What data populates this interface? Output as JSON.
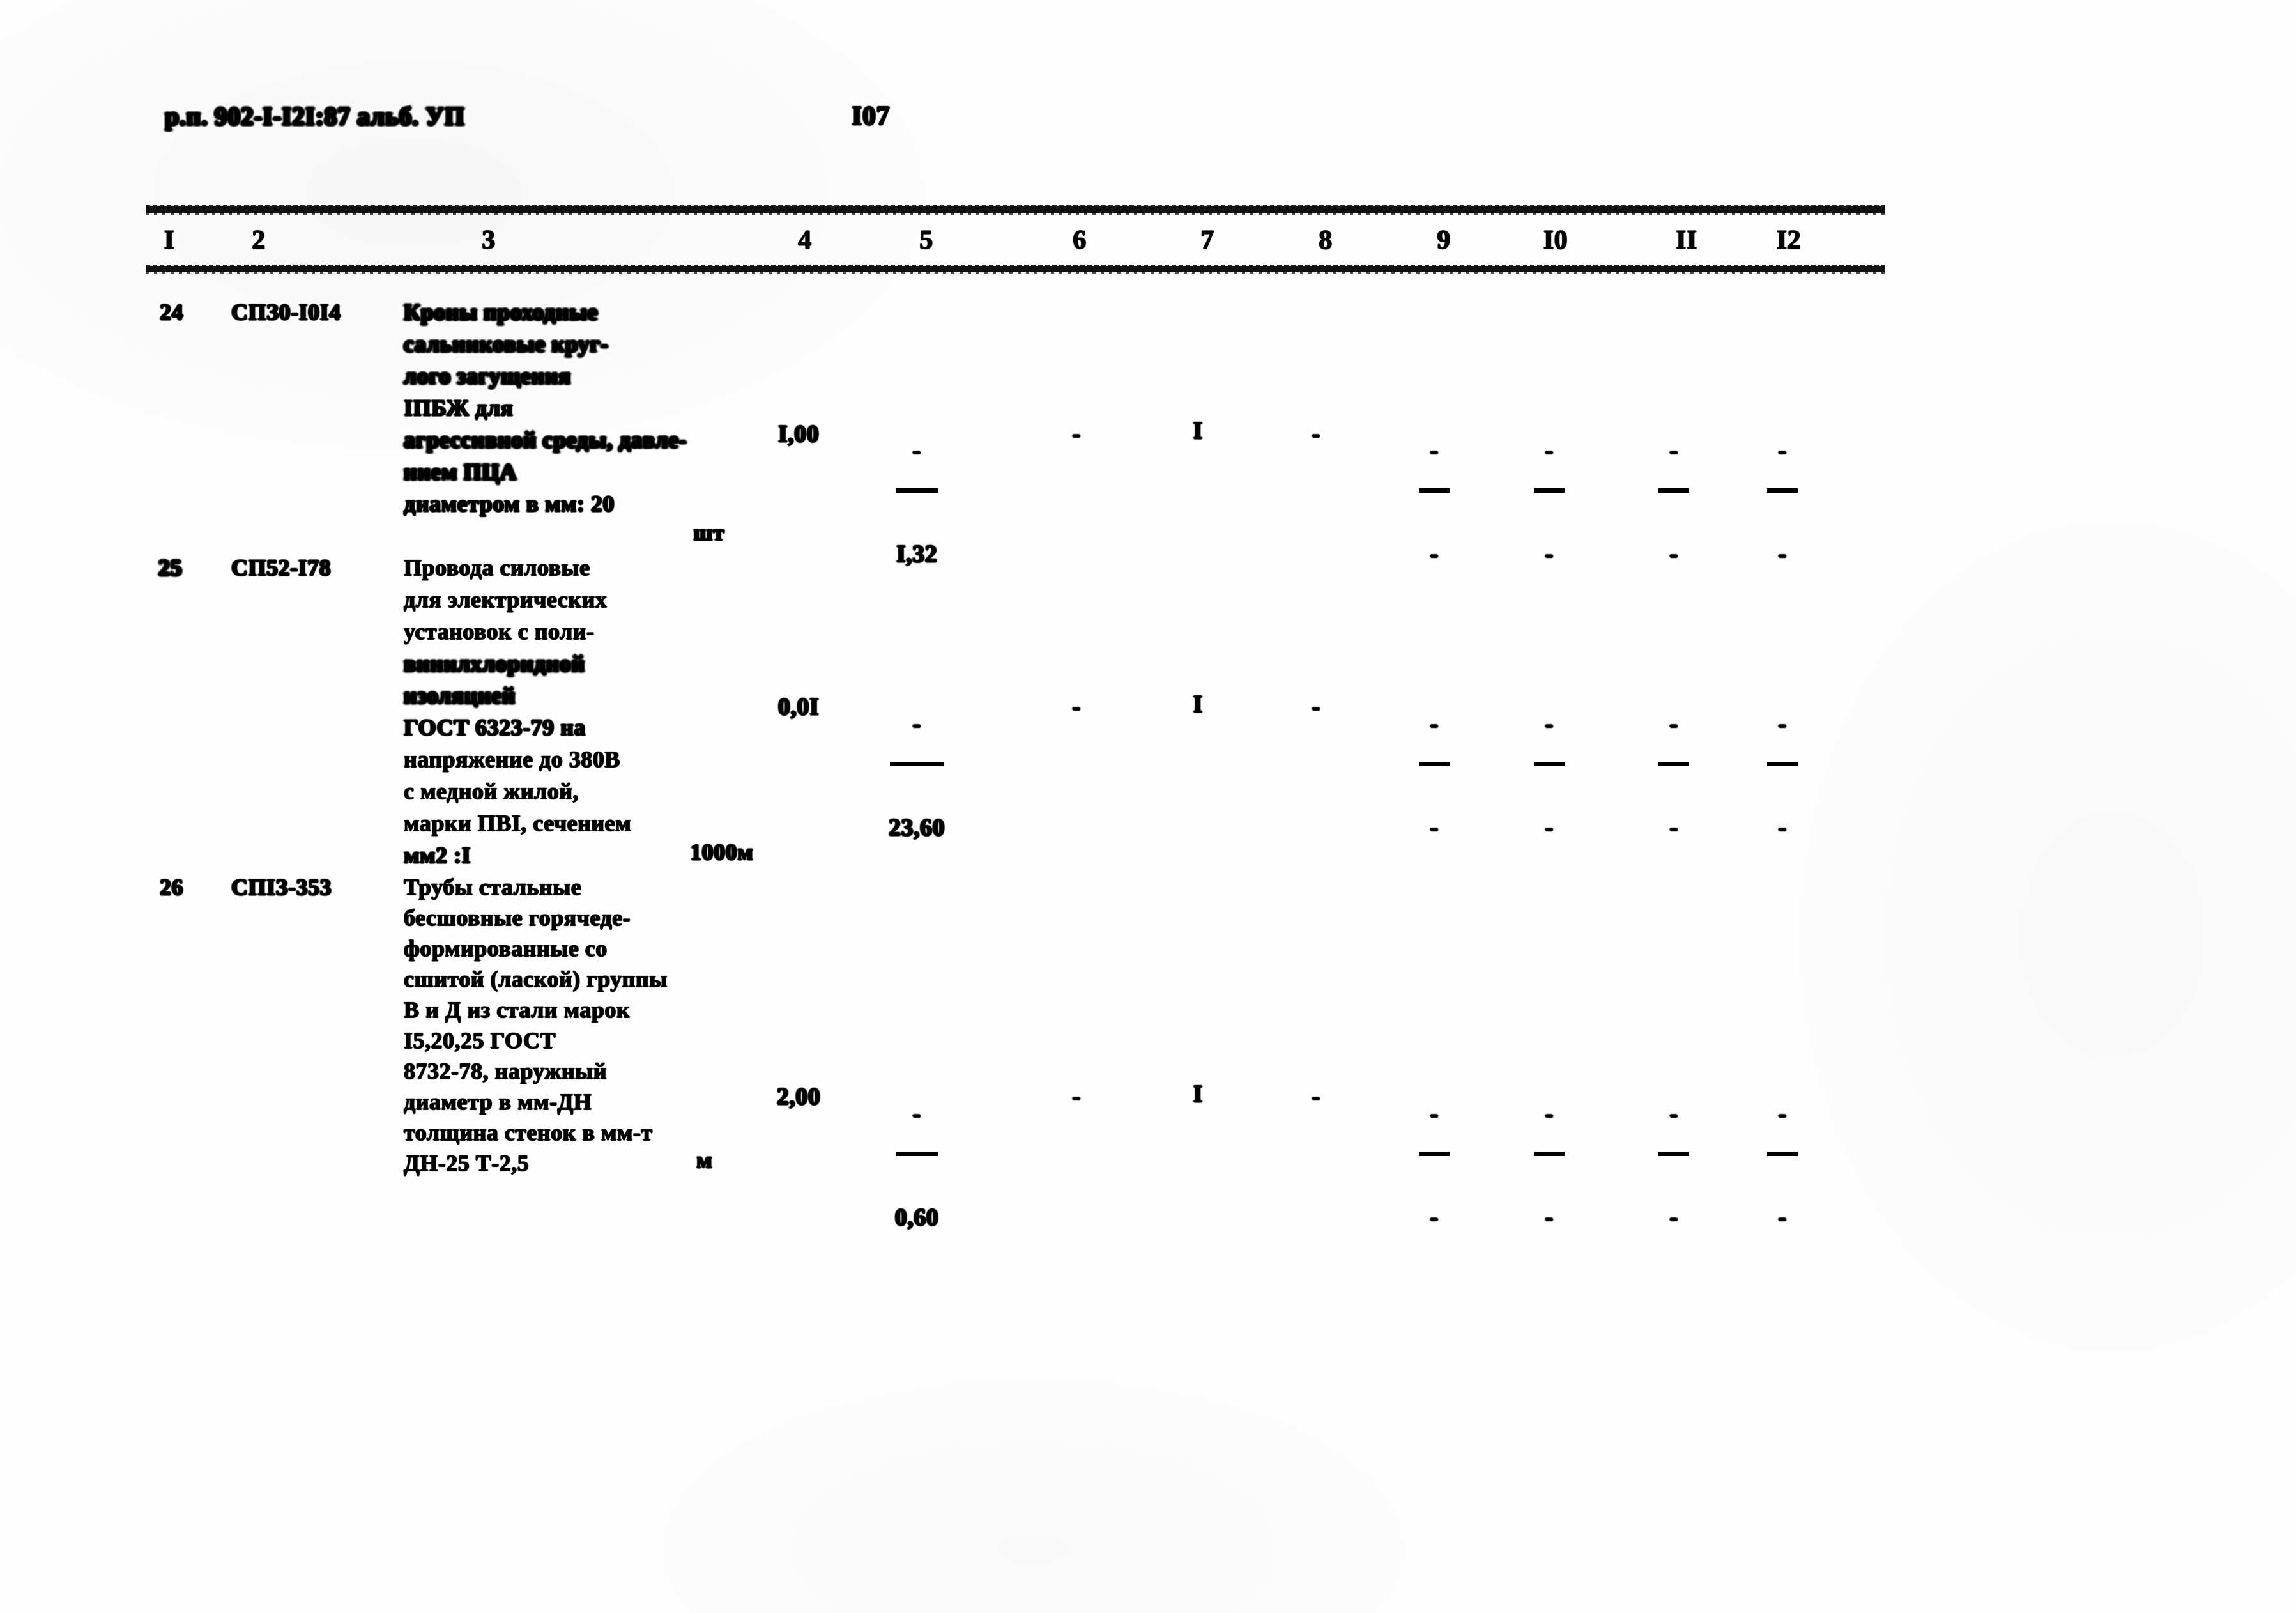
{
  "document": {
    "header_code": "р.п. 902-I-I2I:87 альб. УП",
    "page_number": "I07"
  },
  "table": {
    "column_numbers": [
      "I",
      "2",
      "3",
      "4",
      "5",
      "6",
      "7",
      "8",
      "9",
      "I0",
      "II",
      "I2"
    ],
    "rows": [
      {
        "number": "24",
        "code": "СПЗ0-I0I4",
        "description_lines": [
          "Кроны проходные",
          "сальниковые круг-",
          "лого загущения",
          "IПБЖ для",
          "агрессивной среды, давле-",
          "нием ПЦА",
          "диаметром в мм: 20"
        ],
        "unit": "шт",
        "col4": "I,00",
        "col5": {
          "top": "-",
          "bottom": "I,32"
        },
        "col6": "-",
        "col7": "I",
        "col8": "-",
        "col9": {
          "top": "-",
          "bottom": "-"
        },
        "col10": {
          "top": "-",
          "bottom": "-"
        },
        "col11": {
          "top": "-",
          "bottom": "-"
        },
        "col12": {
          "top": "-",
          "bottom": "-"
        }
      },
      {
        "number": "25",
        "code": "СП52-I78",
        "description_lines": [
          "Провода силовые",
          "для электрических",
          "установок с поли-",
          "винилхлоридной",
          "изоляцией",
          "ГОСТ 6323-79 на",
          "напряжение до 380В",
          "с медной жилой,",
          "марки ПВI, сечением",
          "мм2 :I"
        ],
        "unit": "1000м",
        "col4": "0,0I",
        "col5": {
          "top": "-",
          "bottom": "23,60"
        },
        "col6": "-",
        "col7": "I",
        "col8": "-",
        "col9": {
          "top": "-",
          "bottom": "-"
        },
        "col10": {
          "top": "-",
          "bottom": "-"
        },
        "col11": {
          "top": "-",
          "bottom": "-"
        },
        "col12": {
          "top": "-",
          "bottom": "-"
        }
      },
      {
        "number": "26",
        "code": "СПIЗ-353",
        "description_lines": [
          "Трубы стальные",
          "бесшовные горячеде-",
          "формированные со",
          "сшитой (лаской) группы",
          "В и Д из стали марок",
          "I5,20,25 ГОСТ",
          "8732-78, наружный",
          "диаметр в мм-ДН",
          "толщина стенок в мм-т",
          "ДН-25 Т-2,5"
        ],
        "unit": "м",
        "col4": "2,00",
        "col5": {
          "top": "-",
          "bottom": "0,60"
        },
        "col6": "-",
        "col7": "I",
        "col8": "-",
        "col9": {
          "top": "-",
          "bottom": "-"
        },
        "col10": {
          "top": "-",
          "bottom": "-"
        },
        "col11": {
          "top": "-",
          "bottom": "-"
        },
        "col12": {
          "top": "-",
          "bottom": "-"
        }
      }
    ]
  }
}
